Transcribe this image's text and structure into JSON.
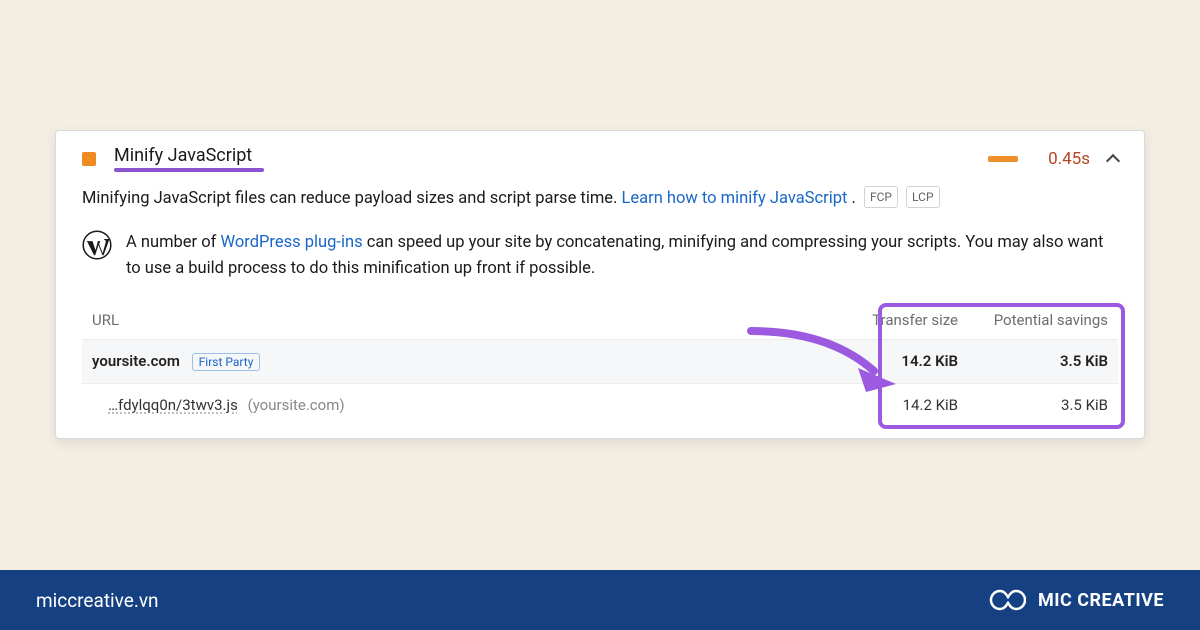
{
  "audit": {
    "title": "Minify JavaScript",
    "timing": "0.45s",
    "description": {
      "pre": "Minifying JavaScript files can reduce payload sizes and script parse time. ",
      "link": "Learn how to minify JavaScript",
      "post": ".",
      "tag1": "FCP",
      "tag2": "LCP"
    },
    "wp_hint": {
      "pre": "A number of ",
      "link": "WordPress plug-ins",
      "post": " can speed up your site by concatenating, minifying and compressing your scripts. You may also want to use a build process to do this minification up front if possible."
    },
    "table": {
      "headers": {
        "url": "URL",
        "transfer": "Transfer size",
        "savings": "Potential savings"
      },
      "summary": {
        "host": "yoursite.com",
        "badge": "First Party",
        "transfer": "14.2 KiB",
        "savings": "3.5 KiB"
      },
      "row": {
        "path": "…fdylqq0n/3twv3.js",
        "origin": "(yoursite.com)",
        "transfer": "14.2 KiB",
        "savings": "3.5 KiB"
      }
    }
  },
  "footer": {
    "site": "miccreative.vn",
    "brand": "MIC CREATIVE"
  }
}
